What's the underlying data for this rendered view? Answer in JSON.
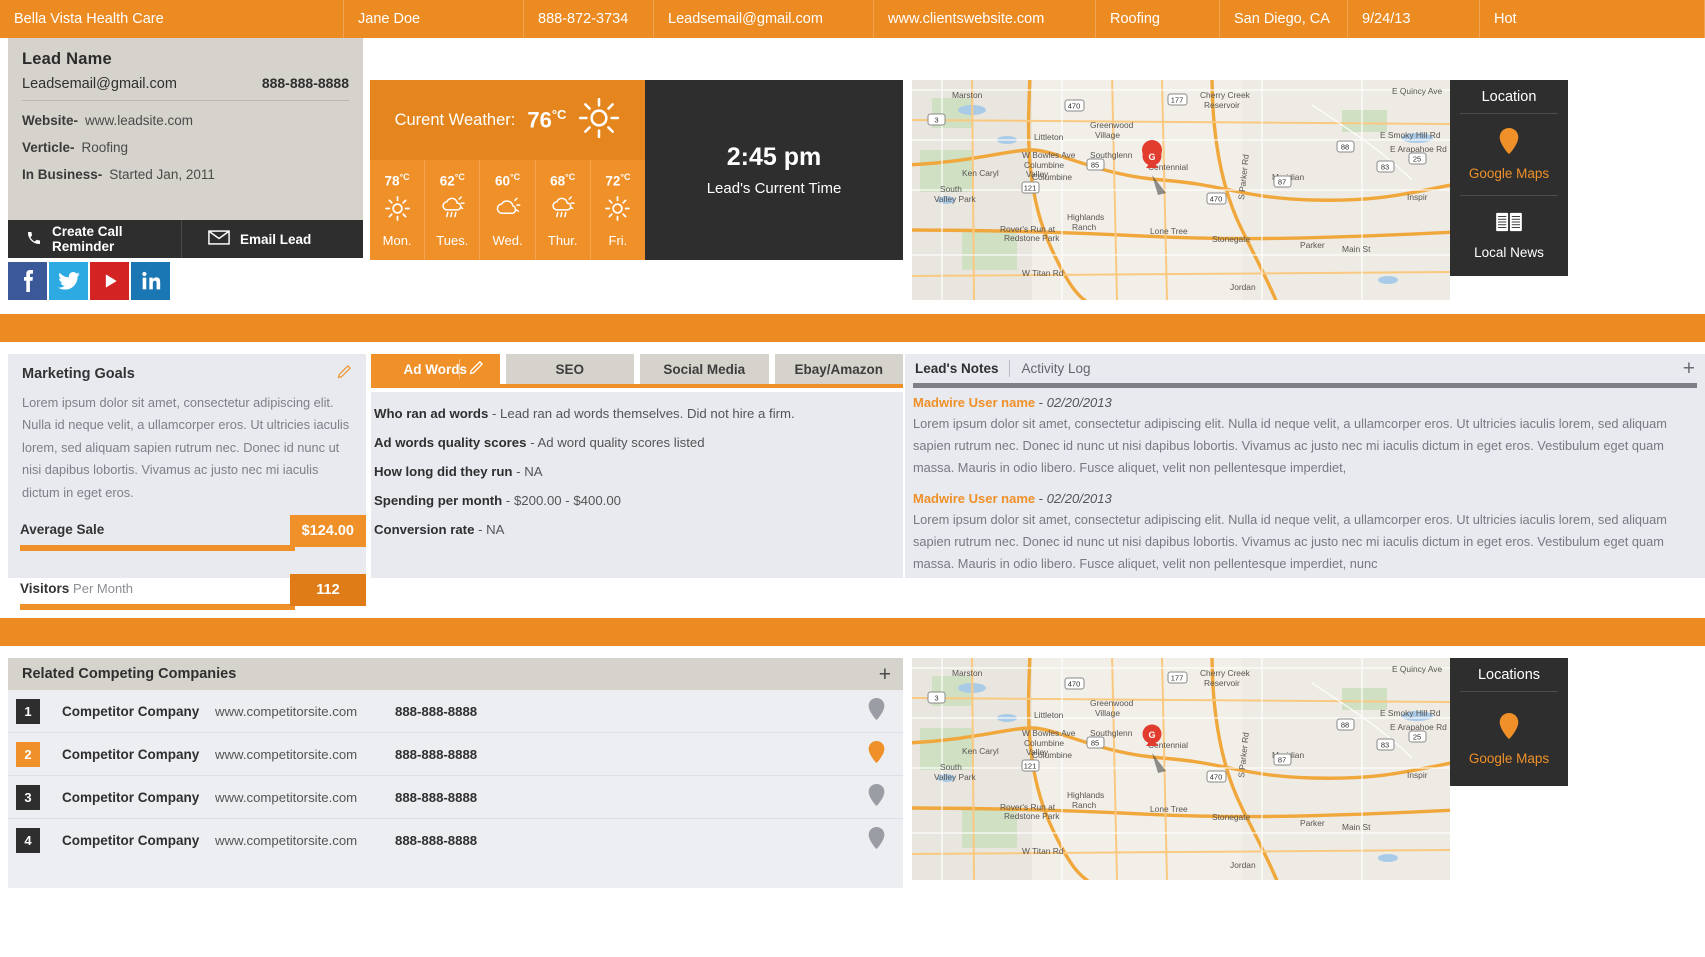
{
  "topbar": {
    "company": "Bella Vista Health Care",
    "contact": "Jane Doe",
    "phone": "888-872-3734",
    "email": "Leadsemail@gmail.com",
    "website": "www.clientswebsite.com",
    "vertical": "Roofing",
    "location": "San Diego, CA",
    "date": "9/24/13",
    "status": "Hot"
  },
  "lead_card": {
    "title": "Lead Name",
    "email": "Leadsemail@gmail.com",
    "phone": "888-888-8888",
    "website_label": "Website-",
    "website_value": "www.leadsite.com",
    "verticle_label": "Verticle-",
    "verticle_value": "Roofing",
    "inbusiness_label": "In Business-",
    "inbusiness_value": "Started Jan, 2011",
    "call_reminder": "Create Call Reminder",
    "email_lead": "Email Lead",
    "socials": [
      "facebook-icon",
      "twitter-icon",
      "youtube-icon",
      "linkedin-icon"
    ]
  },
  "weather": {
    "current_label": "Curent Weather:",
    "current_temp": "76",
    "current_unit": "°C",
    "current_icon": "sun-icon",
    "forecast": [
      {
        "temp": "78",
        "unit": "°C",
        "day": "Mon.",
        "icon": "sun-icon"
      },
      {
        "temp": "62",
        "unit": "°C",
        "day": "Tues.",
        "icon": "rain-sun-icon"
      },
      {
        "temp": "60",
        "unit": "°C",
        "day": "Wed.",
        "icon": "cloud-sun-icon"
      },
      {
        "temp": "68",
        "unit": "°C",
        "day": "Thur.",
        "icon": "rain-sun-icon"
      },
      {
        "temp": "72",
        "unit": "°C",
        "day": "Fri.",
        "icon": "sun-icon"
      }
    ]
  },
  "clock": {
    "time": "2:45 pm",
    "label": "Lead's Current Time"
  },
  "location_panel": {
    "title": "Location",
    "google_maps": "Google Maps",
    "local_news": "Local News"
  },
  "locations_panel": {
    "title": "Locations",
    "google_maps": "Google Maps"
  },
  "marketing_goals": {
    "title": "Marketing Goals",
    "body": "Lorem ipsum dolor sit amet, consectetur adipiscing elit. Nulla id neque velit, a ullamcorper eros. Ut ultricies iaculis lorem, sed aliquam sapien rutrum nec. Donec id nunc ut nisi dapibus lobortis. Vivamus ac justo nec mi iaculis dictum in eget eros.",
    "average_sale_label": "Average Sale",
    "average_sale_value": "$124.00",
    "visitors_label": "Visitors",
    "visitors_sub": "Per Month",
    "visitors_value": "112",
    "edit_icon": "pencil-icon"
  },
  "tabs": [
    {
      "label": "Ad Words",
      "active": true
    },
    {
      "label": "SEO",
      "active": false
    },
    {
      "label": "Social Media",
      "active": false
    },
    {
      "label": "Ebay/Amazon",
      "active": false
    }
  ],
  "adwords": [
    {
      "label": "Who ran ad words",
      "value": "Lead ran ad words themselves.  Did not hire a firm."
    },
    {
      "label": "Ad words quality scores",
      "value": "Ad word quality scores listed"
    },
    {
      "label": "How long did they run",
      "value": "NA"
    },
    {
      "label": "Spending per month",
      "value": "$200.00 - $400.00"
    },
    {
      "label": "Conversion rate",
      "value": "NA"
    }
  ],
  "notes": {
    "tab_active": "Lead's Notes",
    "tab_inactive": "Activity Log",
    "add_label": "+",
    "entries": [
      {
        "author": "Madwire User name",
        "date": "02/20/2013",
        "body": "Lorem ipsum dolor sit amet, consectetur adipiscing elit. Nulla id neque velit, a ullamcorper eros. Ut ultricies iaculis lorem, sed aliquam sapien rutrum nec. Donec id nunc ut nisi dapibus lobortis. Vivamus ac justo nec mi iaculis dictum in eget eros. Vestibulum eget quam massa. Mauris in odio libero. Fusce aliquet, velit non pellentesque imperdiet,"
      },
      {
        "author": "Madwire User name",
        "date": "02/20/2013",
        "body": "Lorem ipsum dolor sit amet, consectetur adipiscing elit. Nulla id neque velit, a ullamcorper eros. Ut ultricies iaculis lorem, sed aliquam sapien rutrum nec. Donec id nunc ut nisi dapibus lobortis. Vivamus ac justo nec mi iaculis dictum in eget eros. Vestibulum eget quam massa. Mauris in odio libero. Fusce aliquet, velit non pellentesque imperdiet, nunc"
      }
    ]
  },
  "competitors": {
    "title": "Related Competing Companies",
    "add_label": "+",
    "rows": [
      {
        "rank": "1",
        "name": "Competitor Company",
        "site": "www.competitorsite.com",
        "phone": "888-888-8888",
        "highlighted": false
      },
      {
        "rank": "2",
        "name": "Competitor Company",
        "site": "www.competitorsite.com",
        "phone": "888-888-8888",
        "highlighted": true
      },
      {
        "rank": "3",
        "name": "Competitor Company",
        "site": "www.competitorsite.com",
        "phone": "888-888-8888",
        "highlighted": false
      },
      {
        "rank": "4",
        "name": "Competitor Company",
        "site": "www.competitorsite.com",
        "phone": "888-888-8888",
        "highlighted": false
      }
    ]
  },
  "map": {
    "marker_label": "G",
    "labels": [
      "Littleton",
      "Greenwood Village",
      "Centennial",
      "Columbine",
      "Columbine Valley",
      "Southglenn",
      "Ken Caryl",
      "South Valley Park",
      "Highlands Ranch",
      "Lone Tree",
      "Stonegate",
      "Parker",
      "Marston",
      "Cherry Creek Reservoir",
      "Inspir",
      "W Bowles Ave",
      "Rover's Run at Redstone Park",
      "W Titan Rd",
      "E Quincy Ave",
      "E Smoky Hill Rd",
      "E Arapahoe Rd",
      "S Parker Rd",
      "Jordan Rd",
      "Main St",
      "Meridian"
    ],
    "shields": [
      "470",
      "85",
      "121",
      "88",
      "83",
      "87",
      "177",
      "25"
    ]
  },
  "colors": {
    "accent": "#ec8b22",
    "accent_light": "#ef9029",
    "dark": "#2e2e2e",
    "card_beige": "#d6d3cc",
    "panel": "#e8eaef"
  }
}
